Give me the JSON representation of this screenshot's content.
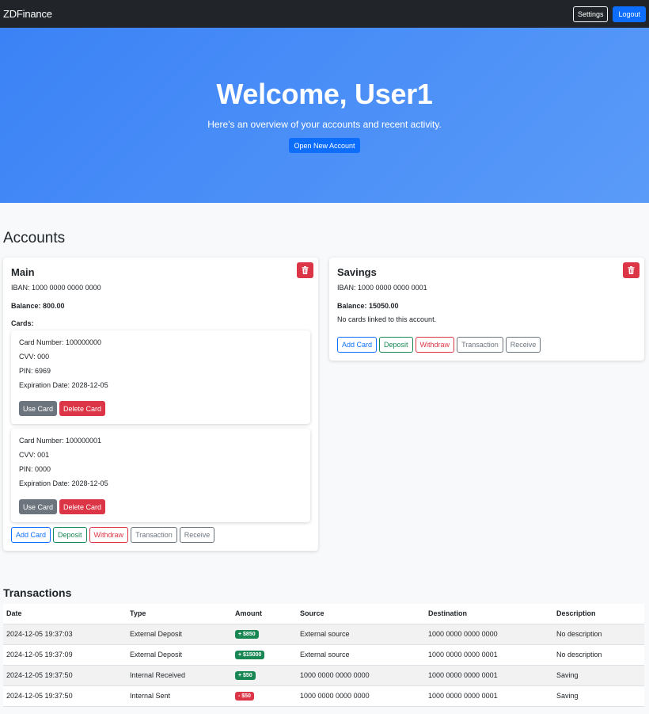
{
  "navbar": {
    "brand": "ZDFinance",
    "settings_label": "Settings",
    "logout_label": "Logout"
  },
  "hero": {
    "title": "Welcome, User1",
    "subtitle": "Here's an overview of your accounts and recent activity.",
    "open_account_label": "Open New Account"
  },
  "accounts_section": {
    "title": "Accounts"
  },
  "accounts": [
    {
      "name": "Main",
      "iban": "IBAN: 1000 0000 0000 0000",
      "balance": "Balance: 800.00",
      "cards_label": "Cards:",
      "cards": [
        {
          "number": "Card Number: 100000000",
          "cvv": "CVV: 000",
          "pin": "PIN: 6969",
          "expiration": "Expiration Date: 2028-12-05",
          "use_label": "Use Card",
          "delete_label": "Delete Card"
        },
        {
          "number": "Card Number: 100000001",
          "cvv": "CVV: 001",
          "pin": "PIN: 0000",
          "expiration": "Expiration Date: 2028-12-05",
          "use_label": "Use Card",
          "delete_label": "Delete Card"
        }
      ]
    },
    {
      "name": "Savings",
      "iban": "IBAN: 1000 0000 0000 0001",
      "balance": "Balance: 15050.00",
      "no_cards": "No cards linked to this account."
    }
  ],
  "account_actions": {
    "add_card": "Add Card",
    "deposit": "Deposit",
    "withdraw": "Withdraw",
    "transaction": "Transaction",
    "receive": "Receive"
  },
  "transactions": {
    "title": "Transactions",
    "columns": [
      "Date",
      "Type",
      "Amount",
      "Source",
      "Destination",
      "Description"
    ],
    "rows": [
      {
        "date": "2024-12-05 19:37:03",
        "type": "External Deposit",
        "amount": "+ $850",
        "direction": "in",
        "source": "External source",
        "destination": "1000 0000 0000 0000",
        "description": "No description"
      },
      {
        "date": "2024-12-05 19:37:09",
        "type": "External Deposit",
        "amount": "+ $15000",
        "direction": "in",
        "source": "External source",
        "destination": "1000 0000 0000 0001",
        "description": "No description"
      },
      {
        "date": "2024-12-05 19:37:50",
        "type": "Internal Received",
        "amount": "+ $50",
        "direction": "in",
        "source": "1000 0000 0000 0000",
        "destination": "1000 0000 0000 0001",
        "description": "Saving"
      },
      {
        "date": "2024-12-05 19:37:50",
        "type": "Internal Sent",
        "amount": "- $50",
        "direction": "out",
        "source": "1000 0000 0000 0000",
        "destination": "1000 0000 0000 0001",
        "description": "Saving"
      }
    ]
  },
  "colors": {
    "navbar": "#212529",
    "primary": "#0d6efd",
    "danger": "#dc3545",
    "success": "#198754",
    "secondary": "#6c757d",
    "hero_start": "#3b82f6",
    "hero_end": "#5a9bf8"
  },
  "icons": {
    "delete_account": "trash-icon"
  }
}
